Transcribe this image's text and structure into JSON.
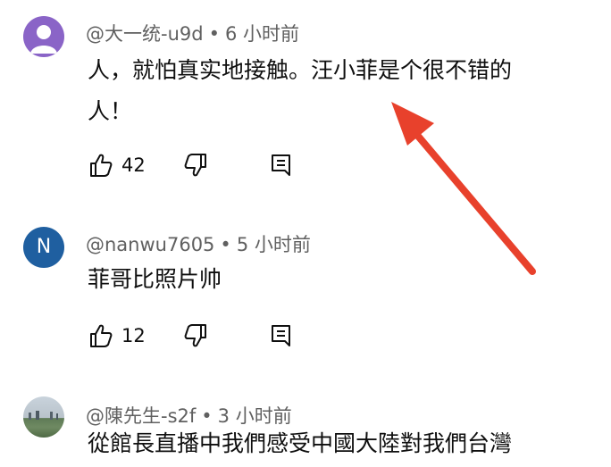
{
  "comments": [
    {
      "author": "@大一统-u9d",
      "time": "6 小时前",
      "text_line1": "人，就怕真实地接触。汪小菲是个很不错的",
      "text_line2": "人！",
      "likes": "42",
      "avatar": {
        "color": "#8a64c7",
        "icon": "person-silhouette-icon"
      }
    },
    {
      "author": "@nanwu7605",
      "time": "5 小时前",
      "text_line1": "菲哥比照片帅",
      "likes": "12",
      "avatar": {
        "letter": "N",
        "color": "#1f5fa0"
      }
    },
    {
      "author": "@陳先生-s2f",
      "time": "3 小时前",
      "text_line1": "從館長直播中我們感受中國大陸對我們台灣",
      "avatar": {
        "icon": "landscape-photo-avatar"
      }
    }
  ],
  "separator": "•",
  "annotation": {
    "color": "#e8412c",
    "icon": "red-arrow-annotation"
  }
}
